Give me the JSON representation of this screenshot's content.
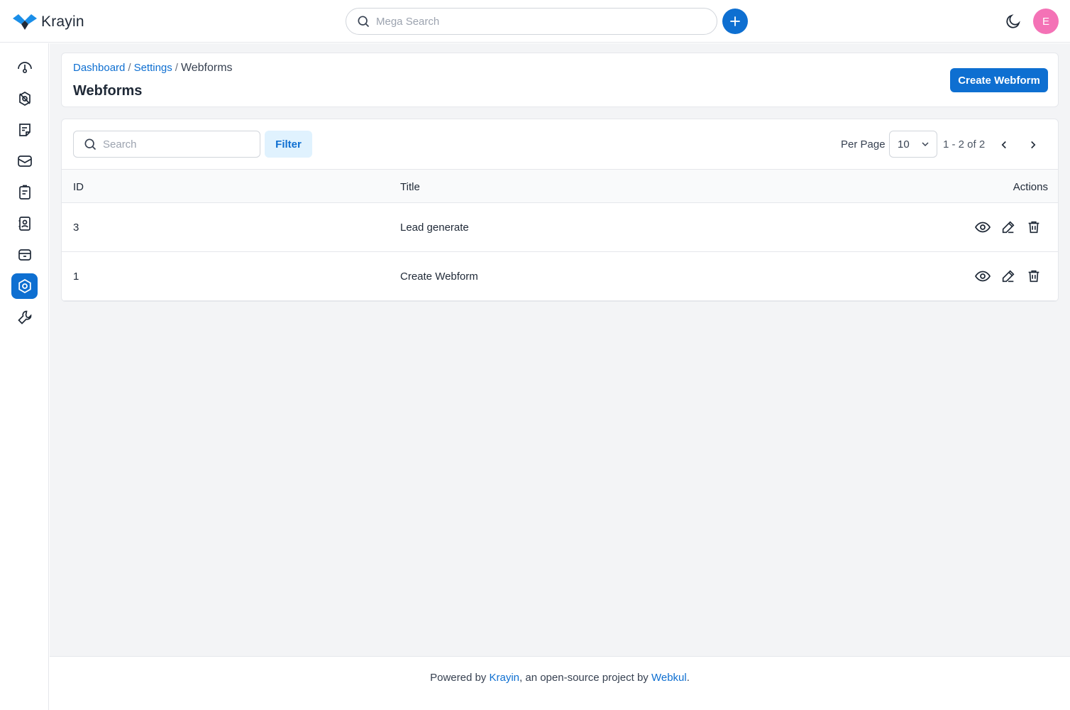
{
  "header": {
    "brand": "Krayin",
    "mega_search_placeholder": "Mega Search",
    "avatar_initial": "E"
  },
  "sidebar": {
    "items": [
      {
        "name": "dashboard",
        "icon": "dashboard-gauge-icon"
      },
      {
        "name": "leads",
        "icon": "leads-icon"
      },
      {
        "name": "quotes",
        "icon": "quotes-icon"
      },
      {
        "name": "mail",
        "icon": "mail-icon"
      },
      {
        "name": "activities",
        "icon": "activities-icon"
      },
      {
        "name": "contacts",
        "icon": "contacts-icon"
      },
      {
        "name": "products",
        "icon": "products-icon"
      },
      {
        "name": "settings",
        "icon": "settings-icon",
        "active": true
      },
      {
        "name": "configuration",
        "icon": "wrench-icon"
      }
    ]
  },
  "breadcrumb": {
    "dashboard": "Dashboard",
    "settings": "Settings",
    "current": "Webforms",
    "separator": "/"
  },
  "page": {
    "title": "Webforms",
    "create_button": "Create Webform"
  },
  "grid": {
    "search_placeholder": "Search",
    "filter_label": "Filter",
    "per_page_label": "Per Page",
    "per_page_value": "10",
    "page_info": "1 - 2 of 2",
    "columns": {
      "id": "ID",
      "title": "Title",
      "actions": "Actions"
    },
    "rows": [
      {
        "id": "3",
        "title": "Lead generate"
      },
      {
        "id": "1",
        "title": "Create Webform"
      }
    ]
  },
  "footer": {
    "prefix": "Powered by ",
    "krayin_link": "Krayin",
    "middle": ", an open-source project by ",
    "webkul_link": "Webkul",
    "suffix": "."
  },
  "colors": {
    "accent": "#0e6fd1",
    "avatar": "#f472b6",
    "background": "#f3f4f6"
  }
}
